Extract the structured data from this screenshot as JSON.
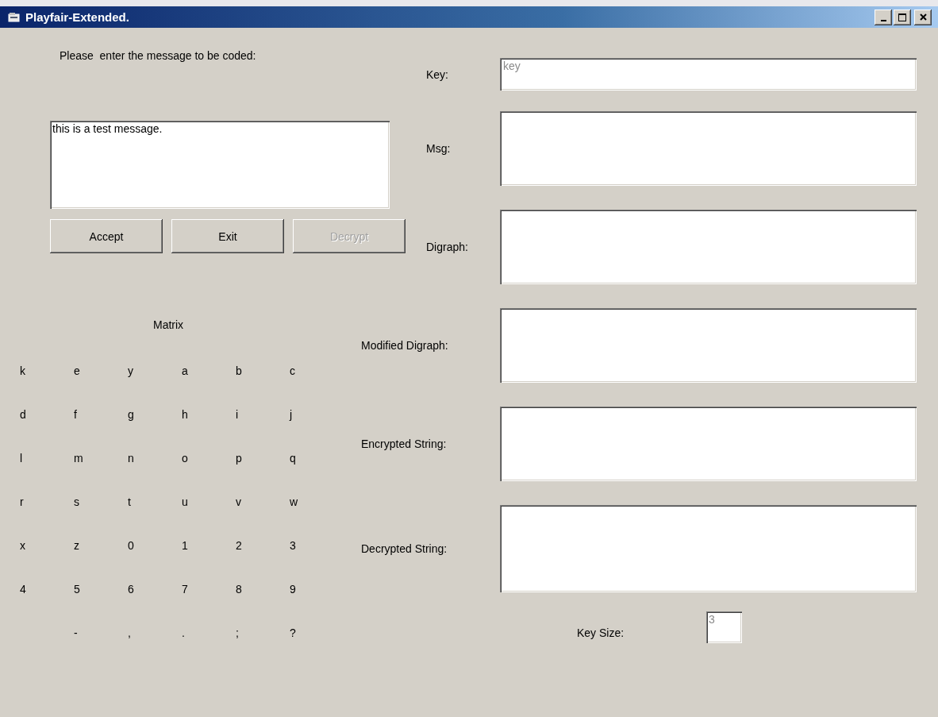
{
  "window": {
    "title": "Playfair-Extended."
  },
  "message": {
    "prompt": "Please  enter the message to be coded:",
    "value": "this is a test message."
  },
  "buttons": [
    {
      "label": "Accept",
      "disabled": false
    },
    {
      "label": "Exit",
      "disabled": false
    },
    {
      "label": "Decrypt",
      "disabled": true
    }
  ],
  "matrix": {
    "title": "Matrix",
    "rows": [
      [
        "k",
        "e",
        "y",
        "a",
        "b",
        "c"
      ],
      [
        "d",
        "f",
        "g",
        "h",
        "i",
        "j"
      ],
      [
        "l",
        "m",
        "n",
        "o",
        "p",
        "q"
      ],
      [
        "r",
        "s",
        "t",
        "u",
        "v",
        "w"
      ],
      [
        "x",
        "z",
        "0",
        "1",
        "2",
        "3"
      ],
      [
        "4",
        "5",
        "6",
        "7",
        "8",
        "9"
      ],
      [
        "",
        "-",
        ",",
        ".",
        ";",
        "?"
      ]
    ]
  },
  "fields": [
    {
      "label": "Key:",
      "value": "key",
      "kind": "line",
      "disabled": true
    },
    {
      "label": "Msg:",
      "kind": "box"
    },
    {
      "label": "Digraph:",
      "kind": "box"
    },
    {
      "label": "Modified Digraph:",
      "kind": "box"
    },
    {
      "label": "Encrypted String:",
      "kind": "box"
    },
    {
      "label": "Decrypted String:",
      "kind": "tall"
    }
  ],
  "key_size": {
    "label": "Key Size:",
    "value": "3",
    "disabled": true
  }
}
